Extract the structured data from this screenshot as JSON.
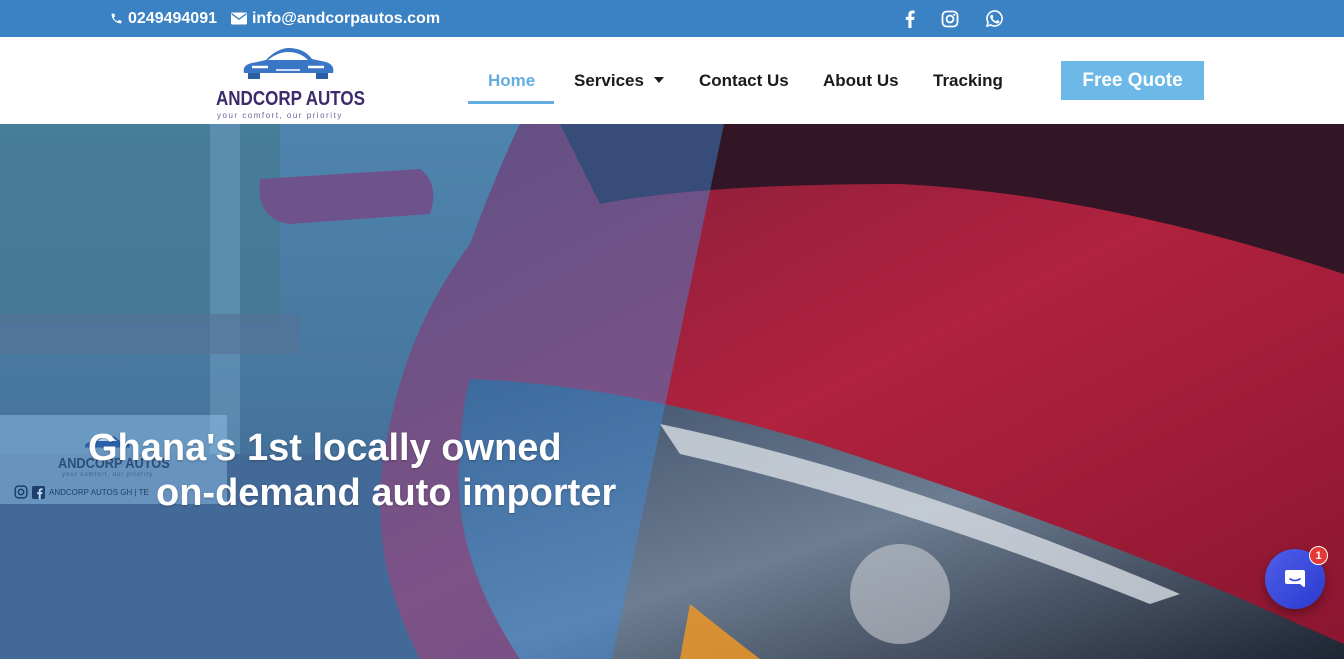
{
  "topbar": {
    "phone": "0249494091",
    "email": "info@andcorpautos.com",
    "social": [
      {
        "icon": "facebook-icon"
      },
      {
        "icon": "instagram-icon"
      },
      {
        "icon": "whatsapp-icon"
      }
    ]
  },
  "logo": {
    "brand": "ANDCORP AUTOS",
    "tagline": "your comfort, our priority"
  },
  "nav": {
    "items": [
      {
        "label": "Home",
        "active": true
      },
      {
        "label": "Services",
        "dropdown": true
      },
      {
        "label": "Contact Us"
      },
      {
        "label": "About Us"
      },
      {
        "label": "Tracking"
      }
    ],
    "cta": "Free Quote"
  },
  "hero": {
    "title_line1": "Ghana's 1st locally owned",
    "title_line2": "on-demand auto importer",
    "watermark": {
      "brand": "ANDCORP AUTOS",
      "tagline": "your comfort, our priority",
      "footer": "ANDCORP AUTOS GH | TE"
    }
  },
  "chat": {
    "badge_count": "1"
  },
  "colors": {
    "topbar": "#3b82c4",
    "accent": "#62aee0",
    "cta": "#6cb8e6",
    "brand_text": "#3c2a6b",
    "chat": "#3a4be0"
  }
}
